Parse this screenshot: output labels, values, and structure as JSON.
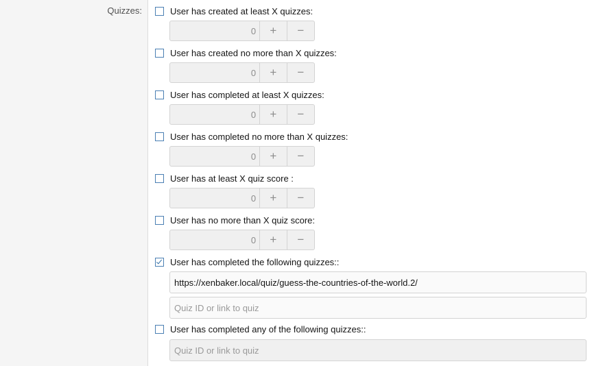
{
  "section_label": "Quizzes:",
  "criteria": [
    {
      "label": "User has created at least X quizzes:",
      "checked": false,
      "value": "0",
      "plus": "+",
      "minus": "−"
    },
    {
      "label": "User has created no more than X quizzes:",
      "checked": false,
      "value": "0",
      "plus": "+",
      "minus": "−"
    },
    {
      "label": "User has completed at least X quizzes:",
      "checked": false,
      "value": "0",
      "plus": "+",
      "minus": "−"
    },
    {
      "label": "User has completed no more than X quizzes:",
      "checked": false,
      "value": "0",
      "plus": "+",
      "minus": "−"
    },
    {
      "label": "User has at least X quiz score :",
      "checked": false,
      "value": "0",
      "plus": "+",
      "minus": "−"
    },
    {
      "label": "User has no more than X quiz score:",
      "checked": false,
      "value": "0",
      "plus": "+",
      "minus": "−"
    }
  ],
  "completed_following": {
    "label": "User has completed the following quizzes::",
    "checked": true,
    "entry_value": "https://xenbaker.local/quiz/guess-the-countries-of-the-world.2/",
    "placeholder": "Quiz ID or link to quiz"
  },
  "completed_any": {
    "label": "User has completed any of the following quizzes::",
    "checked": false,
    "placeholder": "Quiz ID or link to quiz"
  }
}
